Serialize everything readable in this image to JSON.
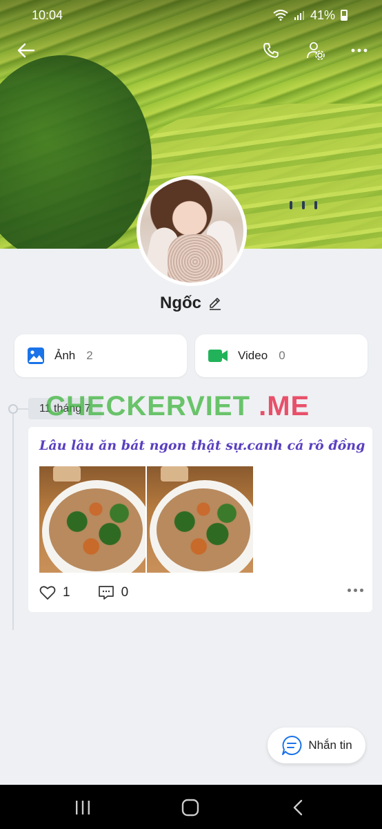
{
  "status_bar": {
    "time": "10:04",
    "battery": "41%"
  },
  "header": {
    "back_icon": "arrow-left-icon",
    "call_icon": "phone-icon",
    "settings_icon": "user-settings-icon",
    "more_icon": "more-horizontal-icon"
  },
  "profile": {
    "name": "Ngốc",
    "edit_icon": "pencil-icon"
  },
  "media": [
    {
      "label": "Ảnh",
      "count": "2",
      "icon": "image-icon",
      "color": "#1a73e8"
    },
    {
      "label": "Video",
      "count": "0",
      "icon": "video-icon",
      "color": "#22b35a"
    }
  ],
  "timeline": {
    "date": "11 tháng 7",
    "watermark_part1": "CHECKERVIET",
    "watermark_part2": ".ME"
  },
  "post": {
    "text": "Lâu lâu ăn bát ngon thật sự.canh cá rô đồng",
    "likes": "1",
    "comments": "0"
  },
  "message_button": {
    "label": "Nhắn tin",
    "icon": "chat-bubble-icon"
  },
  "colors": {
    "accent": "#1a73e8",
    "post_text": "#5a3fc0",
    "video_green": "#22b35a"
  }
}
